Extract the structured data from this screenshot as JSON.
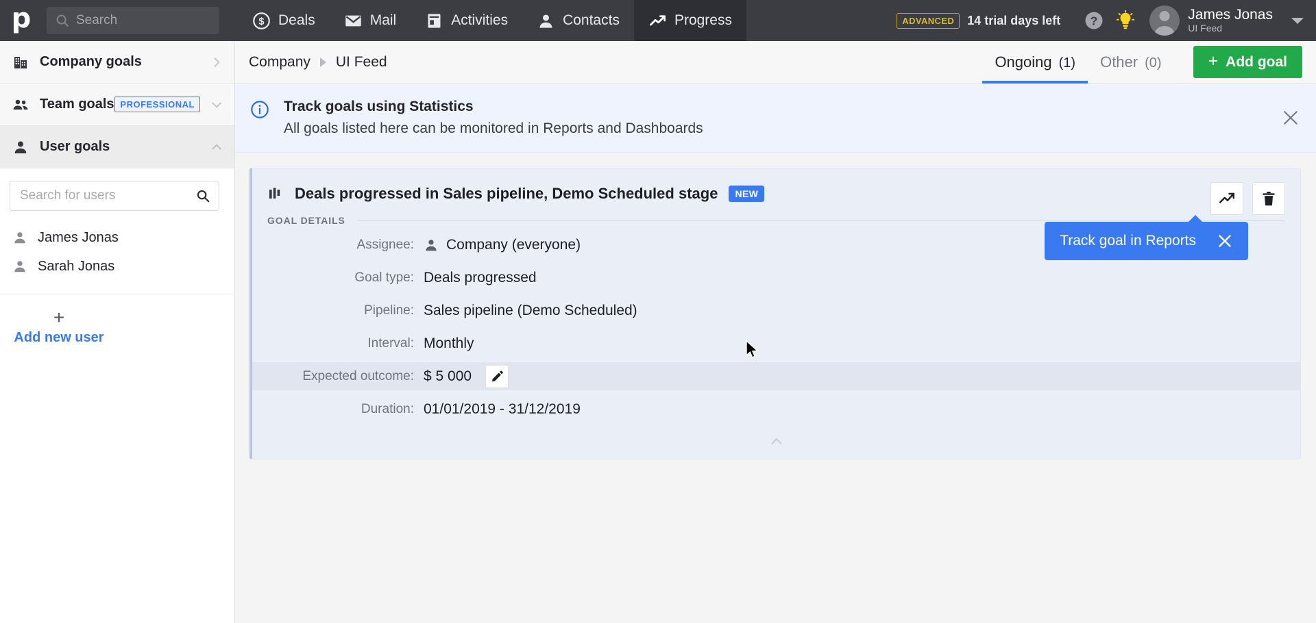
{
  "topnav": {
    "logo": "p",
    "search": {
      "placeholder": "Search",
      "value": "",
      "icon": "search-icon"
    },
    "items": [
      {
        "label": "Deals",
        "icon": "deals-dollar-icon",
        "active": false
      },
      {
        "label": "Mail",
        "icon": "mail-envelope-icon",
        "active": false
      },
      {
        "label": "Activities",
        "icon": "activities-calendar-icon",
        "active": false
      },
      {
        "label": "Contacts",
        "icon": "contacts-person-icon",
        "active": false
      },
      {
        "label": "Progress",
        "icon": "progress-trend-icon",
        "active": true
      }
    ],
    "trial": {
      "plan_badge": "ADVANCED",
      "text": "14 trial days left"
    },
    "help_icon": "help-question-icon",
    "tips_icon": "lightbulb-icon",
    "user": {
      "name": "James Jonas",
      "company": "UI Feed",
      "avatar": "avatar"
    }
  },
  "sidebar": {
    "items": [
      {
        "label": "Company goals",
        "icon": "company-building-icon",
        "chevron": "chevron-right",
        "badge": "",
        "state": "collapsed"
      },
      {
        "label": "Team goals",
        "icon": "team-people-icon",
        "chevron": "chevron-down",
        "badge": "PROFESSIONAL",
        "state": "collapsed"
      },
      {
        "label": "User goals",
        "icon": "user-person-icon",
        "chevron": "chevron-up",
        "badge": "",
        "state": "expanded"
      }
    ],
    "user_search": {
      "placeholder": "Search for users",
      "value": "",
      "icon": "search-icon"
    },
    "users": [
      {
        "name": "James Jonas",
        "icon": "user-person-icon"
      },
      {
        "name": "Sarah Jonas",
        "icon": "user-person-icon"
      }
    ],
    "add_user": {
      "plus": "+",
      "label": "Add new user"
    }
  },
  "main": {
    "breadcrumb": {
      "parent": "Company",
      "current": "UI Feed"
    },
    "tabs": [
      {
        "label": "Ongoing",
        "count": "(1)",
        "selected": true
      },
      {
        "label": "Other",
        "count": "(0)",
        "selected": false
      }
    ],
    "add_goal": {
      "plus": "+",
      "label": "Add goal",
      "color": "#21a94a"
    },
    "banner": {
      "icon": "info-circle-icon",
      "title": "Track goals using Statistics",
      "subtitle": "All goals listed here can be monitored in Reports and Dashboards",
      "close_icon": "close-x-icon"
    },
    "goal_card": {
      "icon": "bar-chart-icon",
      "title": "Deals progressed in Sales pipeline, Demo Scheduled stage",
      "badge": "NEW",
      "actions": [
        {
          "name": "track-in-reports",
          "icon": "trend-up-icon"
        },
        {
          "name": "delete-goal",
          "icon": "trash-icon"
        }
      ],
      "tooltip": {
        "text": "Track goal in Reports",
        "close_icon": "close-x-icon",
        "color": "#3a7af0"
      },
      "section_label": "GOAL DETAILS",
      "details": [
        {
          "label": "Assignee:",
          "value": "Company (everyone)",
          "icon": "user-person-icon",
          "highlight": false,
          "editable": false
        },
        {
          "label": "Goal type:",
          "value": "Deals progressed",
          "icon": "",
          "highlight": false,
          "editable": false
        },
        {
          "label": "Pipeline:",
          "value": "Sales pipeline (Demo Scheduled)",
          "icon": "",
          "highlight": false,
          "editable": false
        },
        {
          "label": "Interval:",
          "value": "Monthly",
          "icon": "",
          "highlight": false,
          "editable": false
        },
        {
          "label": "Expected outcome:",
          "value": "$ 5 000",
          "icon": "",
          "highlight": true,
          "editable": true,
          "edit_icon": "pencil-icon"
        },
        {
          "label": "Duration:",
          "value": "01/01/2019 - 31/12/2019",
          "icon": "",
          "highlight": false,
          "editable": false
        }
      ],
      "collapse_icon": "chevron-up-icon"
    }
  }
}
